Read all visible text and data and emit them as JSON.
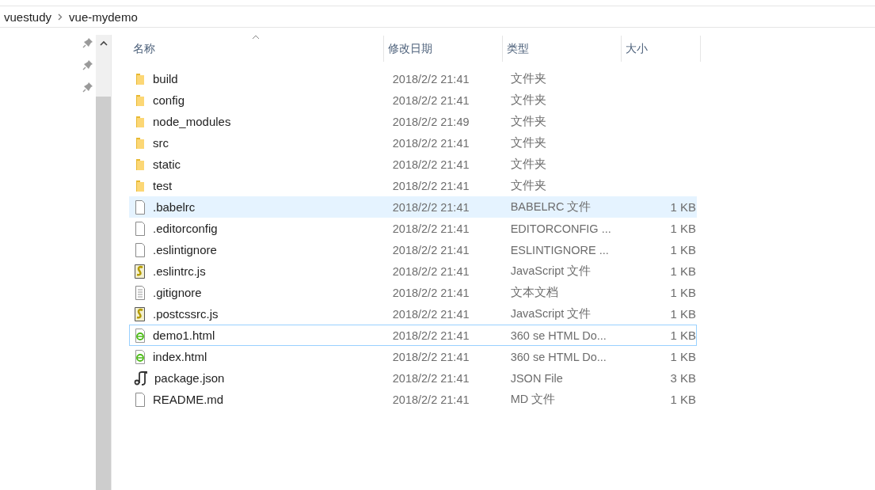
{
  "breadcrumb": [
    "vuestudy",
    "vue-mydemo"
  ],
  "quick_access": [
    {
      "kind": "pin"
    },
    {
      "kind": "pin"
    },
    {
      "kind": "pin"
    }
  ],
  "columns": [
    {
      "label": "名称",
      "sorted": true
    },
    {
      "label": "修改日期",
      "sorted": false
    },
    {
      "label": "类型",
      "sorted": false
    },
    {
      "label": "大小",
      "sorted": false
    }
  ],
  "rows": [
    {
      "kind": "folder",
      "name": "build",
      "modified": "2018/2/2 21:41",
      "type": "文件夹",
      "hovered": false,
      "focused": false
    },
    {
      "kind": "folder",
      "name": "config",
      "modified": "2018/2/2 21:41",
      "type": "文件夹",
      "hovered": false,
      "focused": false
    },
    {
      "kind": "folder",
      "name": "node_modules",
      "modified": "2018/2/2 21:49",
      "type": "文件夹",
      "hovered": false,
      "focused": false
    },
    {
      "kind": "folder",
      "name": "src",
      "modified": "2018/2/2 21:41",
      "type": "文件夹",
      "hovered": false,
      "focused": false
    },
    {
      "kind": "folder",
      "name": "static",
      "modified": "2018/2/2 21:41",
      "type": "文件夹",
      "hovered": false,
      "focused": false
    },
    {
      "kind": "folder",
      "name": "test",
      "modified": "2018/2/2 21:41",
      "type": "文件夹",
      "hovered": false,
      "focused": false
    },
    {
      "kind": "file",
      "name": ".babelrc",
      "modified": "2018/2/2 21:41",
      "type": "BABELRC 文件",
      "size": "1 KB",
      "hovered": true,
      "focused": false
    },
    {
      "kind": "file",
      "name": ".editorconfig",
      "modified": "2018/2/2 21:41",
      "type": "EDITORCONFIG ...",
      "size": "1 KB",
      "hovered": false,
      "focused": false
    },
    {
      "kind": "file",
      "name": ".eslintignore",
      "modified": "2018/2/2 21:41",
      "type": "ESLINTIGNORE ...",
      "size": "1 KB",
      "hovered": false,
      "focused": false
    },
    {
      "kind": "script",
      "name": ".eslintrc.js",
      "modified": "2018/2/2 21:41",
      "type": "JavaScript 文件",
      "size": "1 KB",
      "hovered": false,
      "focused": false
    },
    {
      "kind": "text",
      "name": ".gitignore",
      "modified": "2018/2/2 21:41",
      "type": "文本文档",
      "size": "1 KB",
      "hovered": false,
      "focused": false
    },
    {
      "kind": "script",
      "name": ".postcssrc.js",
      "modified": "2018/2/2 21:41",
      "type": "JavaScript 文件",
      "size": "1 KB",
      "hovered": false,
      "focused": false
    },
    {
      "kind": "html",
      "name": "demo1.html",
      "modified": "2018/2/2 21:41",
      "type": "360 se HTML Do...",
      "size": "1 KB",
      "hovered": false,
      "focused": true
    },
    {
      "kind": "html",
      "name": "index.html",
      "modified": "2018/2/2 21:41",
      "type": "360 se HTML Do...",
      "size": "1 KB",
      "hovered": false,
      "focused": false
    },
    {
      "kind": "json",
      "name": "package.json",
      "modified": "2018/2/2 21:41",
      "type": "JSON File",
      "size": "3 KB",
      "hovered": false,
      "focused": false
    },
    {
      "kind": "file",
      "name": "README.md",
      "modified": "2018/2/2 21:41",
      "type": "MD 文件",
      "size": "1 KB",
      "hovered": false,
      "focused": false
    }
  ]
}
